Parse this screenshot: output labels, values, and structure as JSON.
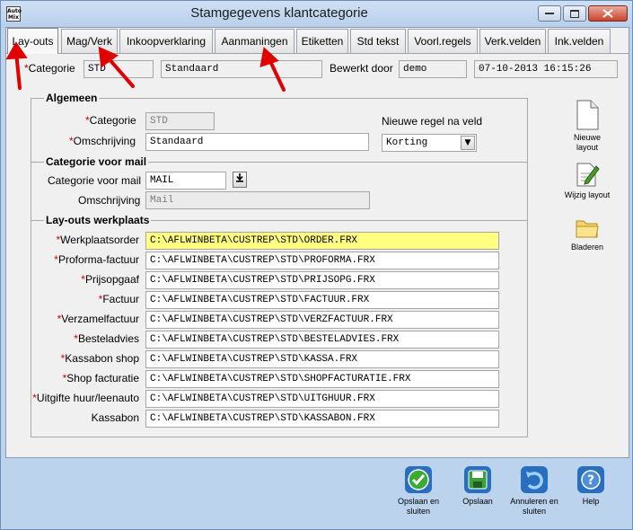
{
  "window": {
    "title": "Stamgegevens klantcategorie",
    "app_icon_text": "Auto Mix"
  },
  "tabs": [
    {
      "label": "Lay-outs",
      "active": true
    },
    {
      "label": "Mag/Verk",
      "active": false
    },
    {
      "label": "Inkoopverklaring",
      "active": false
    },
    {
      "label": "Aanmaningen",
      "active": false
    },
    {
      "label": "Etiketten",
      "active": false
    },
    {
      "label": "Std tekst",
      "active": false
    },
    {
      "label": "Voorl.regels",
      "active": false
    },
    {
      "label": "Verk.velden",
      "active": false
    },
    {
      "label": "Ink.velden",
      "active": false
    }
  ],
  "header": {
    "categorie_label": "Categorie",
    "categorie_code": "STD",
    "categorie_name": "Standaard",
    "bewerkt_door_label": "Bewerkt door",
    "bewerkt_door": "demo",
    "timestamp": "07-10-2013 16:15:26"
  },
  "algemeen": {
    "title": "Algemeen",
    "categorie_label": "Categorie",
    "categorie_value": "STD",
    "omschrijving_label": "Omschrijving",
    "omschrijving_value": "Standaard",
    "nieuwe_regel_label": "Nieuwe regel na veld",
    "nieuwe_regel_value": "Korting"
  },
  "mail": {
    "title": "Categorie voor mail",
    "categorie_label": "Categorie voor mail",
    "categorie_value": "MAIL",
    "omschrijving_label": "Omschrijving",
    "omschrijving_value": "Mail"
  },
  "layouts": {
    "title": "Lay-outs werkplaats",
    "rows": [
      {
        "label": "Werkplaatsorder",
        "required": true,
        "value": "C:\\AFLWINBETA\\CUSTREP\\STD\\ORDER.FRX",
        "highlight": true
      },
      {
        "label": "Proforma-factuur",
        "required": true,
        "value": "C:\\AFLWINBETA\\CUSTREP\\STD\\PROFORMA.FRX",
        "highlight": false
      },
      {
        "label": "Prijsopgaaf",
        "required": true,
        "value": "C:\\AFLWINBETA\\CUSTREP\\STD\\PRIJSOPG.FRX",
        "highlight": false
      },
      {
        "label": "Factuur",
        "required": true,
        "value": "C:\\AFLWINBETA\\CUSTREP\\STD\\FACTUUR.FRX",
        "highlight": false
      },
      {
        "label": "Verzamelfactuur",
        "required": true,
        "value": "C:\\AFLWINBETA\\CUSTREP\\STD\\VERZFACTUUR.FRX",
        "highlight": false
      },
      {
        "label": "Besteladvies",
        "required": true,
        "value": "C:\\AFLWINBETA\\CUSTREP\\STD\\BESTELADVIES.FRX",
        "highlight": false
      },
      {
        "label": "Kassabon shop",
        "required": true,
        "value": "C:\\AFLWINBETA\\CUSTREP\\STD\\KASSA.FRX",
        "highlight": false
      },
      {
        "label": "Shop facturatie",
        "required": true,
        "value": "C:\\AFLWINBETA\\CUSTREP\\STD\\SHOPFACTURATIE.FRX",
        "highlight": false
      },
      {
        "label": "Uitgifte huur/leenauto",
        "required": true,
        "value": "C:\\AFLWINBETA\\CUSTREP\\STD\\UITGHUUR.FRX",
        "highlight": false
      },
      {
        "label": "Kassabon",
        "required": false,
        "value": "C:\\AFLWINBETA\\CUSTREP\\STD\\KASSABON.FRX",
        "highlight": false
      }
    ]
  },
  "side_buttons": {
    "nieuwe_layout": "Nieuwe layout",
    "wijzig_layout": "Wijzig layout",
    "bladeren": "Bladeren"
  },
  "bottom_buttons": {
    "opslaan_en_sluiten": "Opslaan en sluiten",
    "opslaan": "Opslaan",
    "annuleren": "Annuleren en sluiten",
    "help": "Help"
  },
  "colors": {
    "required_asterisk": "#d20000",
    "highlight_field": "#ffff80",
    "annotation_arrow": "#e00000"
  }
}
